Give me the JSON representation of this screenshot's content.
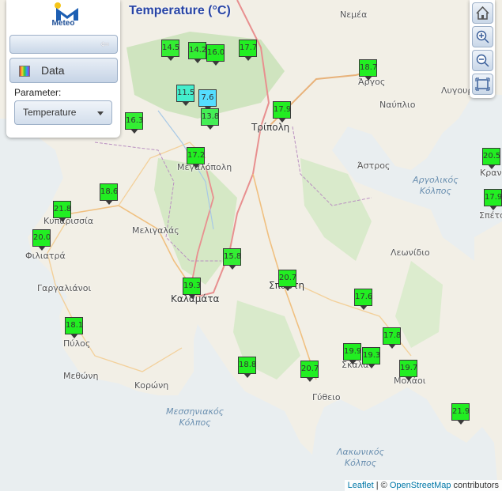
{
  "title": "Temperature (°C)",
  "panel": {
    "logo_text": "Meteo",
    "data_button": "Data",
    "parameter_label": "Parameter:",
    "parameter_value": "Temperature"
  },
  "attribution": {
    "leaflet": "Leaflet",
    "separator": " | © ",
    "osm": "OpenStreetMap",
    "contributors": " contributors"
  },
  "places": {
    "nemea": "Νεμέα",
    "argos": "Άργος",
    "nafplio": "Ναύπλιο",
    "lygourio": "Λυγουριό",
    "tripoli": "Τρίπολη",
    "astros": "Άστρος",
    "megalopoli": "Μεγαλόπολη",
    "kyparissia": "Κυπαρισσία",
    "filiatra": "Φιλιατρά",
    "meligalas": "Μελιγαλάς",
    "gargalianoi": "Γαργαλιάνοι",
    "kalamata": "Καλαμάτα",
    "sparti": "Σπάρτη",
    "leonidio": "Λεωνίδιο",
    "pylos": "Πύλος",
    "methoni": "Μεθώνη",
    "koroni": "Κορώνη",
    "skala": "Σκάλα",
    "molaoi": "Μολάοι",
    "gytheio": "Γύθειο",
    "kranidi": "Κρανίδι",
    "spetses": "Σπέτσες"
  },
  "seas": {
    "argolikos": "Αργολικός\nΚόλπος",
    "messiniakos": "Μεσσηνιακός\nΚόλπος",
    "lakonikos": "Λακωνικός\nΚόλπος"
  },
  "stations": [
    {
      "value": "14.5",
      "color": "#33ee33"
    },
    {
      "value": "14.2",
      "color": "#33ee33"
    },
    {
      "value": "16.0",
      "color": "#22ee22"
    },
    {
      "value": "17.7",
      "color": "#22ee22"
    },
    {
      "value": "18.7",
      "color": "#22ee22"
    },
    {
      "value": "11.5",
      "color": "#44eecc"
    },
    {
      "value": "7.6",
      "color": "#55ddff"
    },
    {
      "value": "13.8",
      "color": "#44ee55"
    },
    {
      "value": "17.9",
      "color": "#22ee22"
    },
    {
      "value": "16.3",
      "color": "#33ee33"
    },
    {
      "value": "17.2",
      "color": "#22ee22"
    },
    {
      "value": "18.6",
      "color": "#22ee22"
    },
    {
      "value": "21.8",
      "color": "#22ee22"
    },
    {
      "value": "20.0",
      "color": "#22ee22"
    },
    {
      "value": "15.8",
      "color": "#33ee33"
    },
    {
      "value": "19.3",
      "color": "#22ee22"
    },
    {
      "value": "20.7",
      "color": "#22ee22"
    },
    {
      "value": "17.6",
      "color": "#22ee22"
    },
    {
      "value": "18.1",
      "color": "#22ee22"
    },
    {
      "value": "17.8",
      "color": "#22ee22"
    },
    {
      "value": "19.9",
      "color": "#22ee22"
    },
    {
      "value": "19.3",
      "color": "#22ee22"
    },
    {
      "value": "18.8",
      "color": "#22ee22"
    },
    {
      "value": "20.7",
      "color": "#22ee22"
    },
    {
      "value": "19.7",
      "color": "#22ee22"
    },
    {
      "value": "21.9",
      "color": "#22ee22"
    },
    {
      "value": "20.5",
      "color": "#22ee22"
    },
    {
      "value": "17.9",
      "color": "#22ee22"
    }
  ]
}
